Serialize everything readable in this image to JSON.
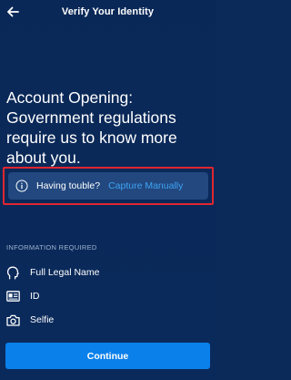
{
  "header": {
    "title": "Verify Your Identity",
    "back_icon": "back-arrow-icon"
  },
  "main": {
    "heading": "Account Opening: Government regulations require us to know more about you."
  },
  "help_banner": {
    "icon": "info-icon",
    "text": "Having touble?",
    "link_label": "Capture Manually",
    "link_color": "#3fa3f3",
    "highlight_color": "#e0262f"
  },
  "requirements": {
    "label": "INFORMATION REQUIRED",
    "items": [
      {
        "icon": "head-profile-icon",
        "label": "Full Legal Name"
      },
      {
        "icon": "id-card-icon",
        "label": "ID"
      },
      {
        "icon": "camera-icon",
        "label": "Selfie"
      }
    ]
  },
  "footer": {
    "continue_label": "Continue",
    "button_color": "#0a80ea"
  },
  "colors": {
    "background": "#0a2857",
    "banner_bg": "#22487f"
  }
}
